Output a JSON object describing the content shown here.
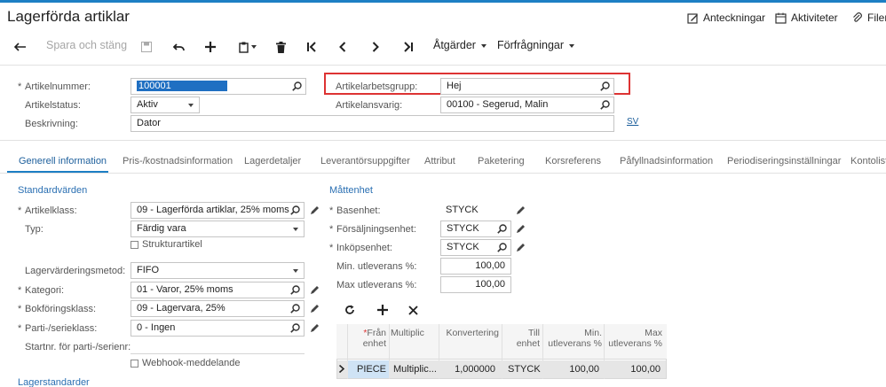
{
  "header": {
    "title": "Lagerförda artiklar",
    "links": {
      "notes": "Anteckningar",
      "activities": "Aktiviteter",
      "files": "Filer"
    }
  },
  "toolbar": {
    "save_close": "Spara och stäng",
    "actions": "Åtgärder",
    "inquiries": "Förfrågningar"
  },
  "form": {
    "item_number": {
      "label": "Artikelnummer:",
      "value": "100001"
    },
    "item_status": {
      "label": "Artikelstatus:",
      "value": "Aktiv"
    },
    "description": {
      "label": "Beskrivning:",
      "value": "Dator"
    },
    "work_group": {
      "label": "Artikelarbetsgrupp:",
      "value": "Hej"
    },
    "manager": {
      "label": "Artikelansvarig:",
      "value": "00100 - Segerud, Malin"
    },
    "sv_link": "SV"
  },
  "tabs": [
    "Generell information",
    "Pris-/kostnadsinformation",
    "Lagerdetaljer",
    "Leverantörsuppgifter",
    "Attribut",
    "Paketering",
    "Korsreferens",
    "Påfyllnadsinformation",
    "Periodiseringsinställningar",
    "Kontolista"
  ],
  "general": {
    "defaults_title": "Standardvärden",
    "item_class": {
      "label": "Artikelklass:",
      "value": "09 - Lagerförda artiklar, 25% moms"
    },
    "type": {
      "label": "Typ:",
      "value": "Färdig vara"
    },
    "kit_item": "Strukturartikel",
    "valuation": {
      "label": "Lagervärderingsmetod:",
      "value": "FIFO"
    },
    "category": {
      "label": "Kategori:",
      "value": "01 - Varor, 25% moms"
    },
    "posting_class": {
      "label": "Bokföringsklass:",
      "value": "09 - Lagervara, 25%"
    },
    "lot_serial": {
      "label": "Parti-/serieklass:",
      "value": "0 - Ingen"
    },
    "start_no": {
      "label": "Startnr. för parti-/serienr:"
    },
    "webhook": "Webhook-meddelande",
    "warehouse_defaults_title": "Lagerstandarder"
  },
  "uom": {
    "title": "Måttenhet",
    "base": {
      "label": "Basenhet:",
      "value": "STYCK"
    },
    "sales": {
      "label": "Försäljningsenhet:",
      "value": "STYCK"
    },
    "purchase": {
      "label": "Inköpsenhet:",
      "value": "STYCK"
    },
    "min_delivery": {
      "label": "Min. utleverans %:",
      "value": "100,00"
    },
    "max_delivery": {
      "label": "Max utleverans %:",
      "value": "100,00"
    },
    "grid": {
      "headers": {
        "from_unit": "Från enhet",
        "multiply": "Multiplic",
        "conversion": "Konvertering",
        "to_unit": "Till enhet",
        "min": "Min. utleverans %",
        "max": "Max utleverans %"
      },
      "rows": [
        {
          "from_unit": "PIECE",
          "multiply": "Multiplic...",
          "conversion": "1,000000",
          "to_unit": "STYCK",
          "min": "100,00",
          "max": "100,00"
        }
      ]
    }
  }
}
